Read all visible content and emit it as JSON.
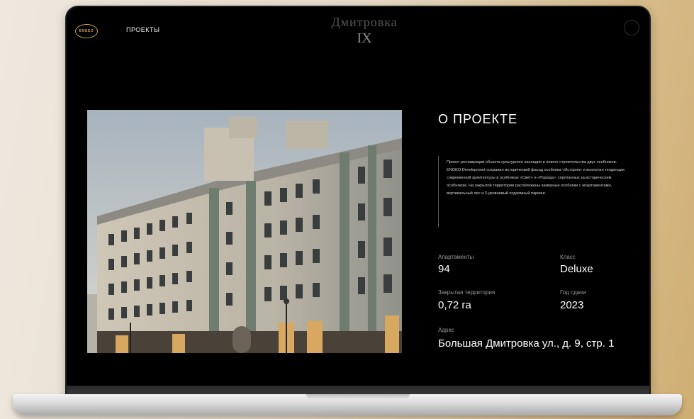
{
  "nav": {
    "logo_text": "ENGEO",
    "projects_label": "ПРОЕКТЫ",
    "brand_line1": "Дмитровка",
    "brand_line2": "IX"
  },
  "about": {
    "title": "О ПРОЕКТЕ",
    "description": "Проект реставрации объекта культурного наследия и нового строительства двух особняков. ENGEO Development сохранил исторический фасад особняка «История» и воплотил тенденции современной архитектуры в особняках «Свет» и «Порода», спрятанных за историческим особняком. На закрытой территории расположены камерные особняки с апартаментами, вертикальный лес и 3-уровневый подземный паркинг."
  },
  "stats": {
    "apartments_label": "Апартаменты",
    "apartments_value": "94",
    "class_label": "Класс",
    "class_value": "Deluxe",
    "territory_label": "Закрытая территория",
    "territory_value": "0,72 га",
    "year_label": "Год сдачи",
    "year_value": "2023",
    "address_label": "Адрес",
    "address_value": "Большая Дмитровка ул., д. 9, стр. 1"
  }
}
